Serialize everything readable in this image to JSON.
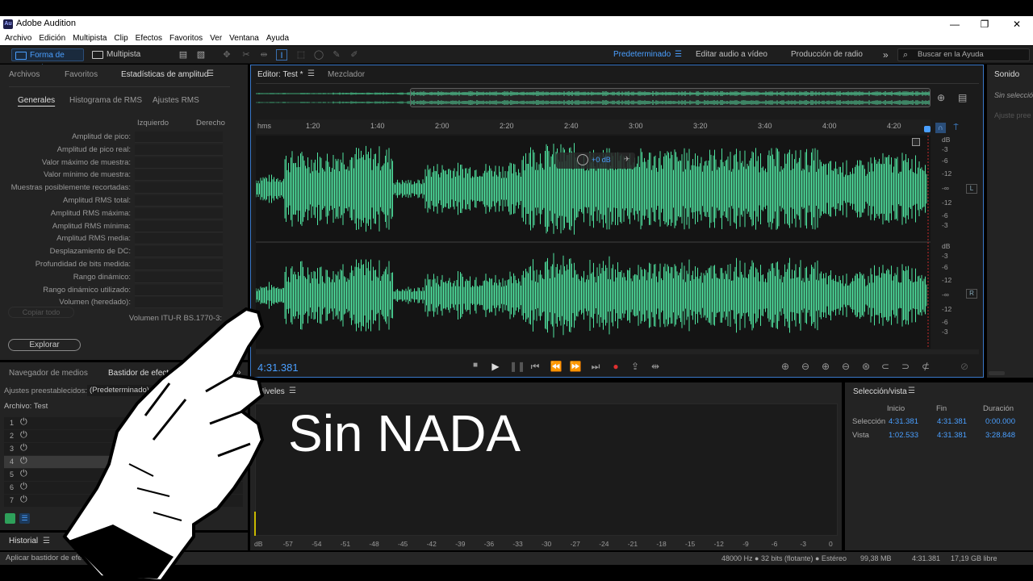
{
  "app": {
    "title": "Adobe Audition",
    "logo": "Au"
  },
  "window_controls": [
    "—",
    "❐",
    "✕"
  ],
  "menu": [
    "Archivo",
    "Edición",
    "Multipista",
    "Clip",
    "Efectos",
    "Favoritos",
    "Ver",
    "Ventana",
    "Ayuda"
  ],
  "toolbar": {
    "mode_waveform": "Forma de onda",
    "mode_multitrack": "Multipista",
    "workspaces": [
      "Predeterminado",
      "Editar audio a vídeo",
      "Producción de radio"
    ],
    "more": "»",
    "search_placeholder": "Buscar en la Ayuda"
  },
  "left_panel": {
    "tabs": [
      "Archivos",
      "Favoritos",
      "Estadísticas de amplitud"
    ],
    "subtabs": [
      "Generales",
      "Histograma de RMS",
      "Ajustes RMS"
    ],
    "col_left": "Izquierdo",
    "col_right": "Derecho",
    "stats": [
      "Amplitud de pico:",
      "Amplitud de pico real:",
      "Valor máximo de muestra:",
      "Valor mínimo de muestra:",
      "Muestras posiblemente recortadas:",
      "Amplitud RMS total:",
      "Amplitud RMS máxima:",
      "Amplitud RMS mínima:",
      "Amplitud RMS media:",
      "Desplazamiento de DC:",
      "Profundidad de bits medida:",
      "Rango dinámico:",
      "Rango dinámico utilizado:",
      "Volumen (heredado):"
    ],
    "copy_all": "Copiar todo",
    "itu_label": "Volumen ITU-R BS.1770-3:",
    "explore": "Explorar"
  },
  "effects_panel": {
    "tabs": [
      "Navegador de medios",
      "Bastidor de efectos"
    ],
    "more": "»",
    "presets_label": "Ajustes preestablecidos:",
    "presets_value": "(Predeterminado)",
    "file_label": "Archivo: Test",
    "slots": [
      "1",
      "2",
      "3",
      "4",
      "5",
      "6",
      "7"
    ]
  },
  "history": {
    "tab": "Historial"
  },
  "status_left": "Aplicar bastidor de efectos ... 5 segundos",
  "editor": {
    "tabs": [
      "Editor: Test *",
      "Mezclador"
    ],
    "timeline_unit": "hms",
    "ticks": [
      "1:20",
      "1:40",
      "2:00",
      "2:20",
      "2:40",
      "3:00",
      "3:20",
      "3:40",
      "4:00",
      "4:20"
    ],
    "gain_hud": "+0 dB",
    "db_scale_top": [
      "dB",
      "-3",
      "-6",
      "-12",
      "-∞",
      "-12",
      "-6",
      "-3"
    ],
    "db_scale_bottom": [
      "dB",
      "-3",
      "-6",
      "-12",
      "-∞",
      "-12",
      "-6",
      "-3"
    ],
    "channel_left": "L",
    "channel_right": "R",
    "timecode": "4:31.381",
    "wave_color": "#4fe3a0"
  },
  "right_panel": {
    "tab": "Sonido",
    "no_selection": "Sin selecció",
    "adjust": "Ajuste pree"
  },
  "levels": {
    "title": "Niveles",
    "scale": [
      "dB",
      "-57",
      "-54",
      "-51",
      "-48",
      "-45",
      "-42",
      "-39",
      "-36",
      "-33",
      "-30",
      "-27",
      "-24",
      "-21",
      "-18",
      "-15",
      "-12",
      "-9",
      "-6",
      "-3",
      "0"
    ]
  },
  "overlay_text": "Sin NADA",
  "selection_view": {
    "title": "Selección/vista",
    "headers": [
      "Inicio",
      "Fin",
      "Duración"
    ],
    "rows": [
      {
        "label": "Selección",
        "start": "4:31.381",
        "end": "4:31.381",
        "duration": "0:00.000"
      },
      {
        "label": "Vista",
        "start": "1:02.533",
        "end": "4:31.381",
        "duration": "3:28.848"
      }
    ]
  },
  "status_bar": {
    "format": "48000 Hz ● 32 bits (flotante) ● Estéreo",
    "size": "99,38 MB",
    "duration": "4:31.381",
    "free": "17,19 GB libre"
  }
}
